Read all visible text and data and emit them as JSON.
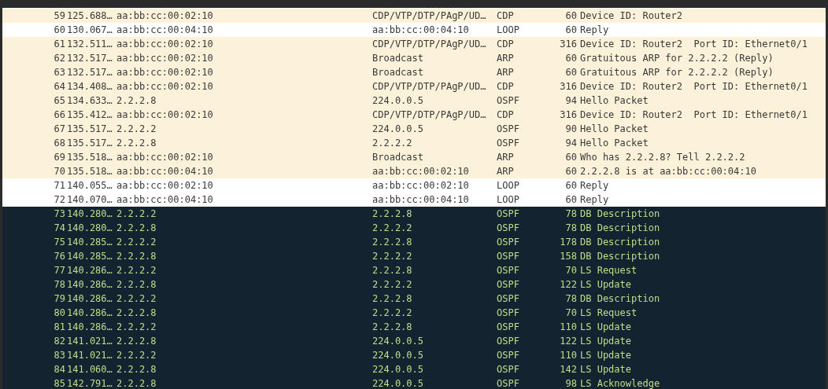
{
  "packets": [
    {
      "no": "59",
      "time": "125.688…",
      "source": "aa:bb:cc:00:02:10",
      "destination": "CDP/VTP/DTP/PAgP/UD…",
      "protocol": "CDP",
      "length": "60",
      "info": "Device ID: Router2",
      "color": "#fcf2da",
      "selected": false
    },
    {
      "no": "60",
      "time": "130.067…",
      "source": "aa:bb:cc:00:04:10",
      "destination": "aa:bb:cc:00:04:10",
      "protocol": "LOOP",
      "length": "60",
      "info": "Reply",
      "color": "#ffffff",
      "selected": false
    },
    {
      "no": "61",
      "time": "132.511…",
      "source": "aa:bb:cc:00:02:10",
      "destination": "CDP/VTP/DTP/PAgP/UD…",
      "protocol": "CDP",
      "length": "316",
      "info": "Device ID: Router2  Port ID: Ethernet0/1",
      "color": "#fcf2da",
      "selected": false
    },
    {
      "no": "62",
      "time": "132.517…",
      "source": "aa:bb:cc:00:02:10",
      "destination": "Broadcast",
      "protocol": "ARP",
      "length": "60",
      "info": "Gratuitous ARP for 2.2.2.2 (Reply)",
      "color": "#fcf2da",
      "selected": false
    },
    {
      "no": "63",
      "time": "132.517…",
      "source": "aa:bb:cc:00:02:10",
      "destination": "Broadcast",
      "protocol": "ARP",
      "length": "60",
      "info": "Gratuitous ARP for 2.2.2.2 (Reply)",
      "color": "#fcf2da",
      "selected": false
    },
    {
      "no": "64",
      "time": "134.408…",
      "source": "aa:bb:cc:00:02:10",
      "destination": "CDP/VTP/DTP/PAgP/UD…",
      "protocol": "CDP",
      "length": "316",
      "info": "Device ID: Router2  Port ID: Ethernet0/1",
      "color": "#fcf2da",
      "selected": false
    },
    {
      "no": "65",
      "time": "134.633…",
      "source": "2.2.2.8",
      "destination": "224.0.0.5",
      "protocol": "OSPF",
      "length": "94",
      "info": "Hello Packet",
      "color": "#fcf2da",
      "selected": false
    },
    {
      "no": "66",
      "time": "135.412…",
      "source": "aa:bb:cc:00:02:10",
      "destination": "CDP/VTP/DTP/PAgP/UD…",
      "protocol": "CDP",
      "length": "316",
      "info": "Device ID: Router2  Port ID: Ethernet0/1",
      "color": "#fcf2da",
      "selected": false
    },
    {
      "no": "67",
      "time": "135.517…",
      "source": "2.2.2.2",
      "destination": "224.0.0.5",
      "protocol": "OSPF",
      "length": "90",
      "info": "Hello Packet",
      "color": "#fcf2da",
      "selected": false
    },
    {
      "no": "68",
      "time": "135.517…",
      "source": "2.2.2.8",
      "destination": "2.2.2.2",
      "protocol": "OSPF",
      "length": "94",
      "info": "Hello Packet",
      "color": "#fcf2da",
      "selected": false
    },
    {
      "no": "69",
      "time": "135.518…",
      "source": "aa:bb:cc:00:02:10",
      "destination": "Broadcast",
      "protocol": "ARP",
      "length": "60",
      "info": "Who has 2.2.2.8? Tell 2.2.2.2",
      "color": "#fcf2da",
      "selected": false
    },
    {
      "no": "70",
      "time": "135.518…",
      "source": "aa:bb:cc:00:04:10",
      "destination": "aa:bb:cc:00:02:10",
      "protocol": "ARP",
      "length": "60",
      "info": "2.2.2.8 is at aa:bb:cc:00:04:10",
      "color": "#fcf2da",
      "selected": false
    },
    {
      "no": "71",
      "time": "140.055…",
      "source": "aa:bb:cc:00:02:10",
      "destination": "aa:bb:cc:00:02:10",
      "protocol": "LOOP",
      "length": "60",
      "info": "Reply",
      "color": "#ffffff",
      "selected": false
    },
    {
      "no": "72",
      "time": "140.070…",
      "source": "aa:bb:cc:00:04:10",
      "destination": "aa:bb:cc:00:04:10",
      "protocol": "LOOP",
      "length": "60",
      "info": "Reply",
      "color": "#ffffff",
      "selected": false
    },
    {
      "no": "73",
      "time": "140.280…",
      "source": "2.2.2.2",
      "destination": "2.2.2.8",
      "protocol": "OSPF",
      "length": "78",
      "info": "DB Description",
      "selected": true
    },
    {
      "no": "74",
      "time": "140.280…",
      "source": "2.2.2.8",
      "destination": "2.2.2.2",
      "protocol": "OSPF",
      "length": "78",
      "info": "DB Description",
      "selected": true
    },
    {
      "no": "75",
      "time": "140.285…",
      "source": "2.2.2.2",
      "destination": "2.2.2.8",
      "protocol": "OSPF",
      "length": "178",
      "info": "DB Description",
      "selected": true
    },
    {
      "no": "76",
      "time": "140.285…",
      "source": "2.2.2.8",
      "destination": "2.2.2.2",
      "protocol": "OSPF",
      "length": "158",
      "info": "DB Description",
      "selected": true
    },
    {
      "no": "77",
      "time": "140.286…",
      "source": "2.2.2.2",
      "destination": "2.2.2.8",
      "protocol": "OSPF",
      "length": "70",
      "info": "LS Request",
      "selected": true
    },
    {
      "no": "78",
      "time": "140.286…",
      "source": "2.2.2.8",
      "destination": "2.2.2.2",
      "protocol": "OSPF",
      "length": "122",
      "info": "LS Update",
      "selected": true
    },
    {
      "no": "79",
      "time": "140.286…",
      "source": "2.2.2.2",
      "destination": "2.2.2.8",
      "protocol": "OSPF",
      "length": "78",
      "info": "DB Description",
      "selected": true
    },
    {
      "no": "80",
      "time": "140.286…",
      "source": "2.2.2.8",
      "destination": "2.2.2.2",
      "protocol": "OSPF",
      "length": "70",
      "info": "LS Request",
      "selected": true
    },
    {
      "no": "81",
      "time": "140.286…",
      "source": "2.2.2.2",
      "destination": "2.2.2.8",
      "protocol": "OSPF",
      "length": "110",
      "info": "LS Update",
      "selected": true
    },
    {
      "no": "82",
      "time": "141.021…",
      "source": "2.2.2.8",
      "destination": "224.0.0.5",
      "protocol": "OSPF",
      "length": "122",
      "info": "LS Update",
      "selected": true
    },
    {
      "no": "83",
      "time": "141.021…",
      "source": "2.2.2.2",
      "destination": "224.0.0.5",
      "protocol": "OSPF",
      "length": "110",
      "info": "LS Update",
      "selected": true
    },
    {
      "no": "84",
      "time": "141.060…",
      "source": "2.2.2.8",
      "destination": "224.0.0.5",
      "protocol": "OSPF",
      "length": "142",
      "info": "LS Update",
      "selected": true
    },
    {
      "no": "85",
      "time": "142.791…",
      "source": "2.2.2.8",
      "destination": "224.0.0.5",
      "protocol": "OSPF",
      "length": "98",
      "info": "LS Acknowledge",
      "selected": true
    }
  ]
}
